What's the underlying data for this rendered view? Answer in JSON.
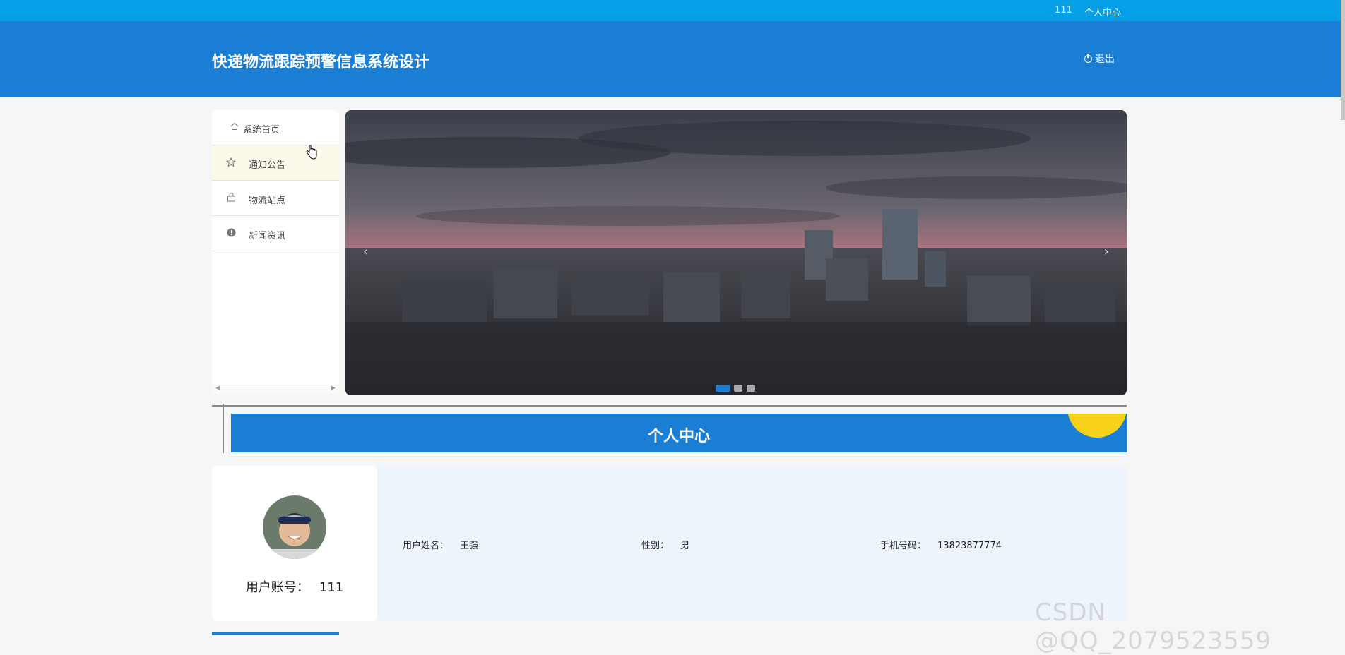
{
  "topbar": {
    "account": "111",
    "user_center": "个人中心"
  },
  "header": {
    "title": "快递物流跟踪预警信息系统设计",
    "logout": "退出"
  },
  "sidebar": {
    "items": [
      {
        "label": "系统首页",
        "icon": "home-icon"
      },
      {
        "label": "通知公告",
        "icon": "star-icon"
      },
      {
        "label": "物流站点",
        "icon": "bag-icon"
      },
      {
        "label": "新闻资讯",
        "icon": "info-icon"
      }
    ]
  },
  "carousel": {
    "current_slide": 1,
    "total_slides": 3
  },
  "section": {
    "title": "个人中心"
  },
  "profile": {
    "account_label": "用户账号：",
    "account_value": "111",
    "name_label": "用户姓名：",
    "name_value": "王强",
    "gender_label": "性别：",
    "gender_value": "男",
    "phone_label": "手机号码：",
    "phone_value": "13823877774"
  },
  "watermark": "CSDN @QQ_2079523559",
  "colors": {
    "topbar": "#05a0e8",
    "header": "#1a7fd4",
    "accent_yellow": "#f7d21b",
    "active_menu": "#fdf9ea"
  }
}
